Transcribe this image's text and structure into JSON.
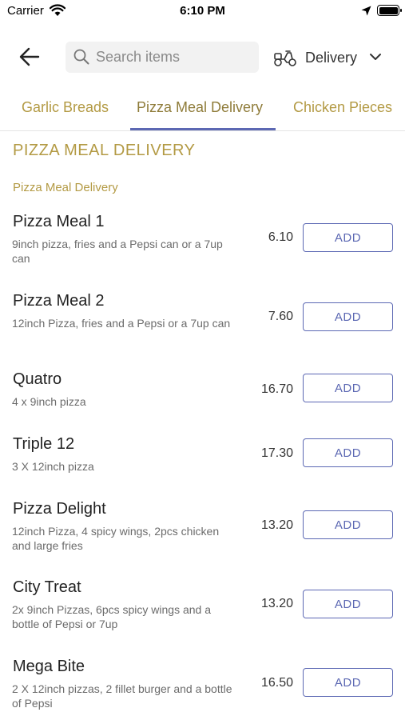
{
  "status_bar": {
    "carrier": "Carrier",
    "time": "6:10 PM"
  },
  "header": {
    "back_icon": "arrow-left-icon",
    "search": {
      "placeholder": "Search items",
      "value": ""
    },
    "delivery": {
      "label": "Delivery",
      "icon": "scooter-icon"
    }
  },
  "tabs": [
    {
      "label": "Garlic Breads",
      "active": false
    },
    {
      "label": "Pizza Meal Delivery",
      "active": true
    },
    {
      "label": "Chicken Pieces",
      "active": false
    }
  ],
  "section": {
    "title": "PIZZA MEAL DELIVERY",
    "subtitle": "Pizza Meal Delivery"
  },
  "items": [
    {
      "name": "Pizza Meal 1",
      "desc": " 9inch pizza, fries and a Pepsi can or a 7up can",
      "price": "6.10",
      "button": "ADD"
    },
    {
      "name": "Pizza Meal 2",
      "desc": "12inch Pizza, fries and a Pepsi or a 7up can",
      "price": "7.60",
      "button": "ADD"
    },
    {
      "name": "Quatro",
      "desc": "4 x 9inch pizza",
      "price": "16.70",
      "button": "ADD"
    },
    {
      "name": "Triple 12",
      "desc": "3 X 12inch pizza",
      "price": "17.30",
      "button": "ADD"
    },
    {
      "name": "Pizza Delight",
      "desc": "12inch Pizza, 4 spicy wings, 2pcs chicken and large fries",
      "price": "13.20",
      "button": "ADD"
    },
    {
      "name": "City Treat",
      "desc": "2x 9inch Pizzas, 6pcs spicy wings and a bottle of Pepsi or 7up",
      "price": "13.20",
      "button": "ADD"
    },
    {
      "name": "Mega Bite",
      "desc": "2 X 12inch pizzas, 2 fillet burger and a bottle of Pepsi",
      "price": "16.50",
      "button": "ADD"
    }
  ],
  "colors": {
    "accent": "#5c68b3",
    "gold": "#b39a44",
    "text": "#222222",
    "muted": "#6b6b6b"
  }
}
